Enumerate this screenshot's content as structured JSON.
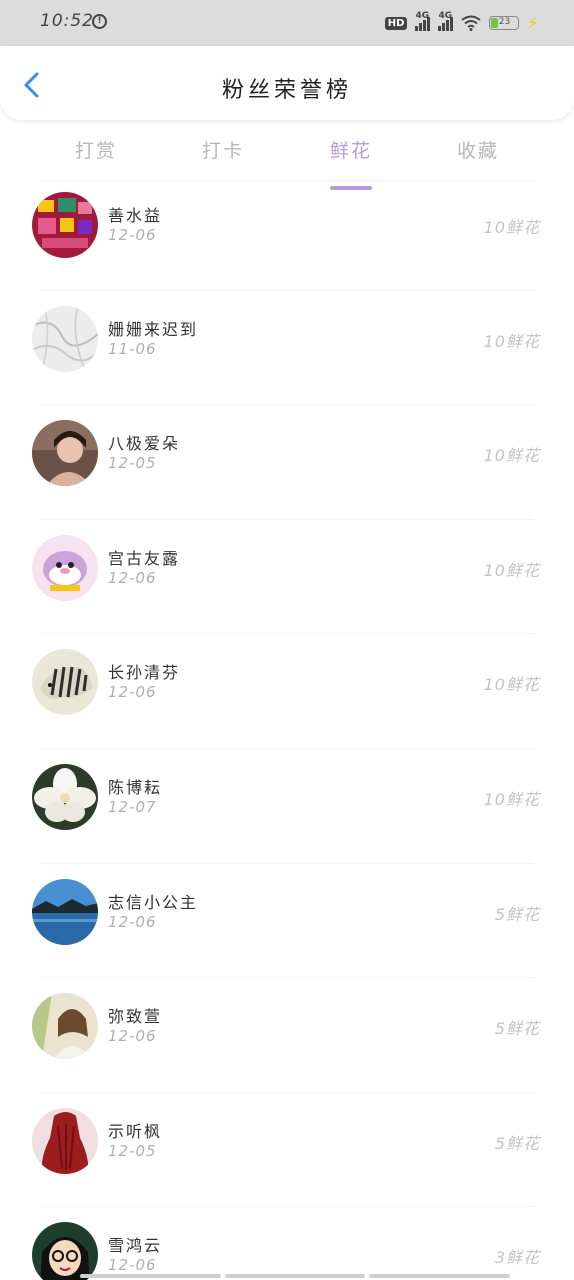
{
  "status": {
    "time": "10:52",
    "network_1": "4G",
    "network_2": "4G",
    "hd": "HD",
    "battery": "23"
  },
  "header": {
    "title": "粉丝荣誉榜"
  },
  "tabs": [
    {
      "label": "打赏"
    },
    {
      "label": "打卡"
    },
    {
      "label": "鲜花"
    },
    {
      "label": "收藏"
    }
  ],
  "active_tab": "鲜花",
  "colors": {
    "accent": "#b39ddb",
    "back_arrow": "#3a8ee6"
  },
  "rows": [
    {
      "name": "善水益",
      "date": "12-06",
      "amount": "10鲜花",
      "avatar": "gift-collage-avatar"
    },
    {
      "name": "姗姗来迟到",
      "date": "11-06",
      "amount": "10鲜花",
      "avatar": "marble-avatar"
    },
    {
      "name": "八极爱朵",
      "date": "12-05",
      "amount": "10鲜花",
      "avatar": "portrait-avatar"
    },
    {
      "name": "宫古友露",
      "date": "12-06",
      "amount": "10鲜花",
      "avatar": "cartoon-avatar"
    },
    {
      "name": "长孙清芬",
      "date": "12-06",
      "amount": "10鲜花",
      "avatar": "zebra-avatar"
    },
    {
      "name": "陈博耘",
      "date": "12-07",
      "amount": "10鲜花",
      "avatar": "white-flower-avatar"
    },
    {
      "name": "志信小公主",
      "date": "12-06",
      "amount": "5鲜花",
      "avatar": "lake-avatar"
    },
    {
      "name": "弥致萱",
      "date": "12-06",
      "amount": "5鲜花",
      "avatar": "girl-avatar"
    },
    {
      "name": "示听枫",
      "date": "12-05",
      "amount": "5鲜花",
      "avatar": "red-dress-avatar"
    },
    {
      "name": "雪鸿云",
      "date": "12-06",
      "amount": "3鲜花",
      "avatar": "cartoon-girl-avatar"
    }
  ]
}
